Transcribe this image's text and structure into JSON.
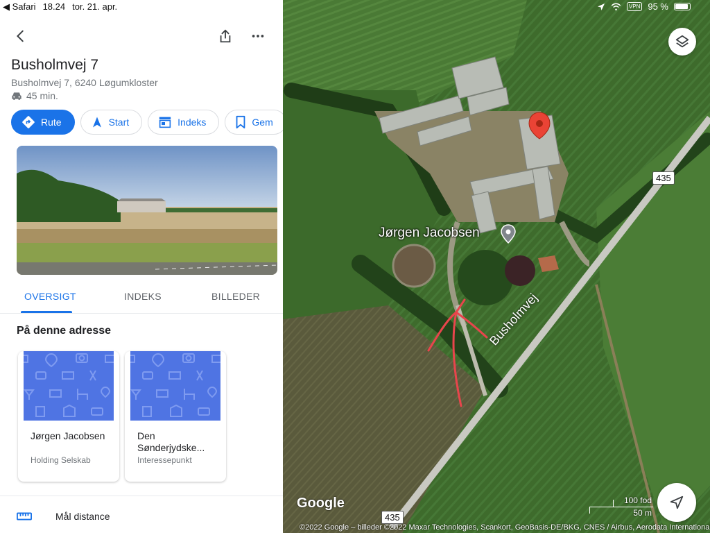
{
  "status_bar": {
    "back_app": "Safari",
    "time": "18.24",
    "date": "tor. 21. apr.",
    "vpn": "VPN",
    "battery": "95 %"
  },
  "place": {
    "title": "Busholmvej 7",
    "address": "Busholmvej 7, 6240 Løgumkloster",
    "drive_time": "45 min."
  },
  "actions": [
    {
      "label": "Rute",
      "icon": "directions-icon"
    },
    {
      "label": "Start",
      "icon": "navigation-arrow-icon"
    },
    {
      "label": "Indeks",
      "icon": "storefront-icon"
    },
    {
      "label": "Gem",
      "icon": "bookmark-icon"
    }
  ],
  "tabs": {
    "overview": "OVERSIGT",
    "index": "INDEKS",
    "photos": "BILLEDER",
    "active": "OVERSIGT"
  },
  "section": {
    "title": "På denne adresse"
  },
  "cards": [
    {
      "name": "Jørgen Jacobsen",
      "subtitle": "Holding Selskab"
    },
    {
      "name": "Den Sønderjydske...",
      "subtitle": "Interessepunkt"
    }
  ],
  "measure": {
    "label": "Mål distance"
  },
  "map": {
    "poi_label": "Jørgen Jacobsen",
    "road_name": "Busholmvej",
    "route_number_top": "435",
    "route_number_bottom": "435",
    "logo": "Google",
    "scale_feet": "100 fod",
    "scale_meters": "50 m",
    "attribution": "©2022 Google – billeder ©2022 Maxar Technologies, Scankort, GeoBasis-DE/BKG, CNES / Airbus, Aerodata International",
    "pin_color": "#ea4335"
  },
  "colors": {
    "accent": "#1a73e8",
    "card_image": "#4f74e3"
  }
}
